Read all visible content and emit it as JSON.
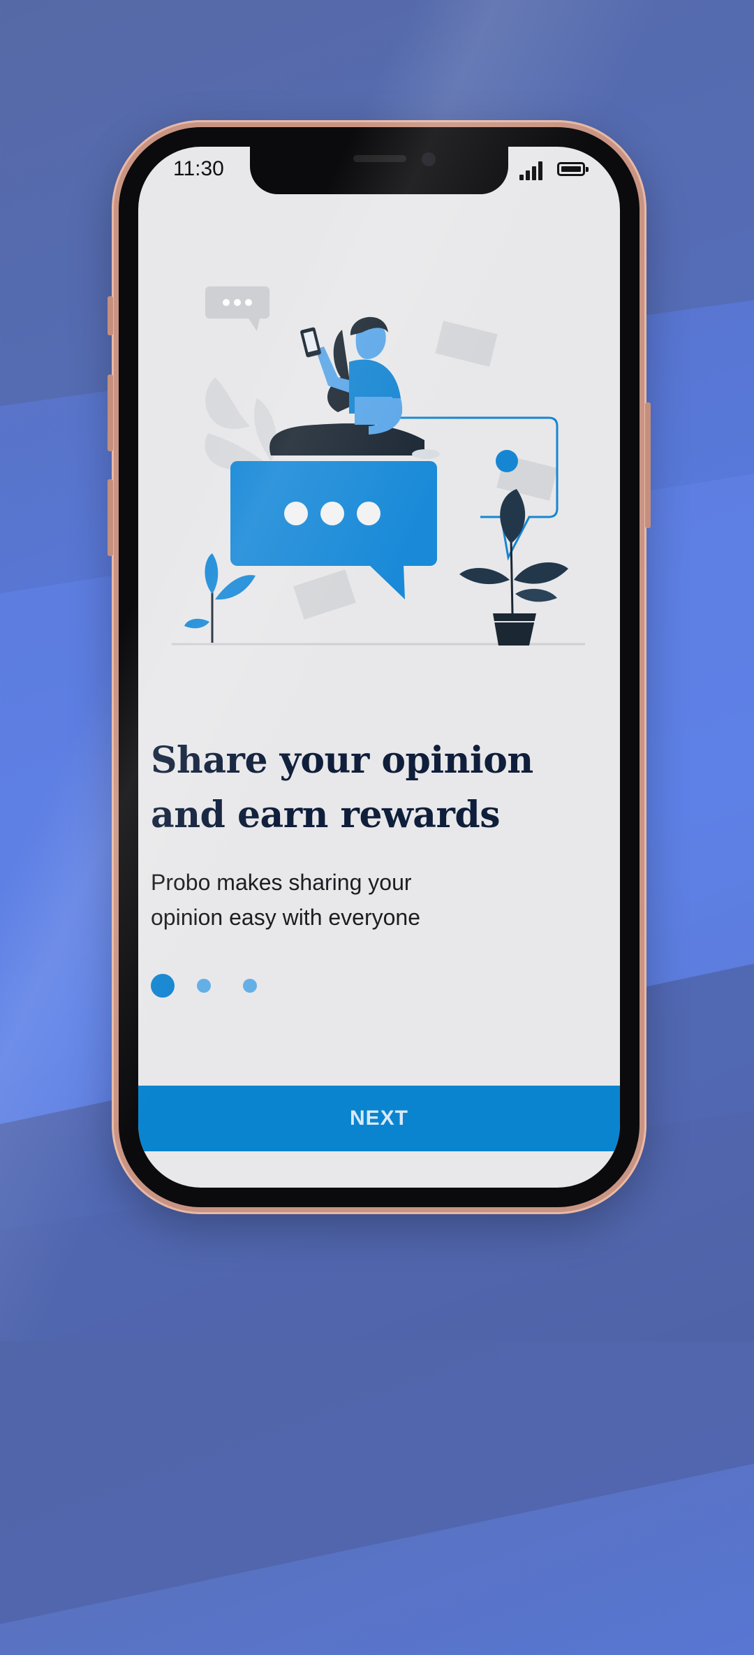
{
  "status_bar": {
    "time": "11:30",
    "signal_icon": "cellular-signal-icon",
    "battery_icon": "battery-full-icon"
  },
  "onboarding": {
    "headline_line1": "Share your opinion",
    "headline_line2": "and earn rewards",
    "subtitle_line1": "Probo makes sharing your",
    "subtitle_line2": "opinion easy with everyone",
    "pager": {
      "total": 3,
      "current": 1
    },
    "next_label": "NEXT"
  },
  "colors": {
    "accent": "#0b84d0",
    "headline": "#0f1e3a",
    "screen_bg": "#e8e8ea",
    "background": "#5877d6"
  }
}
